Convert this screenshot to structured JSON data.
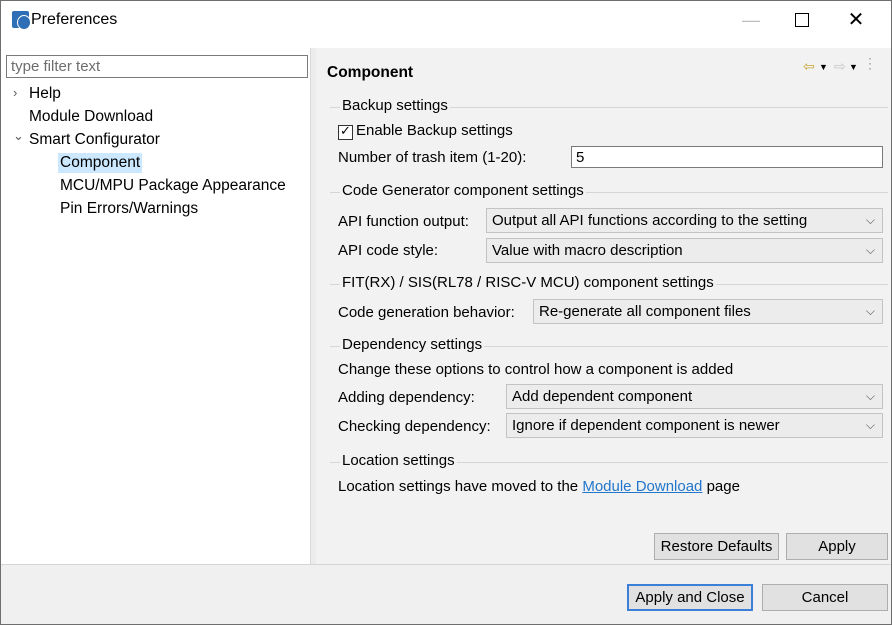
{
  "window": {
    "title": "Preferences",
    "minimize": "—",
    "close": "✕"
  },
  "left": {
    "filter_placeholder": "type filter text",
    "tree": [
      {
        "label": "Help",
        "expander": "›"
      },
      {
        "label": "Module Download"
      },
      {
        "label": "Smart Configurator",
        "expander": "⌄"
      },
      {
        "label": "Component",
        "selected": true
      },
      {
        "label": "MCU/MPU Package Appearance"
      },
      {
        "label": "Pin Errors/Warnings"
      }
    ]
  },
  "right": {
    "page_title": "Component",
    "nav": {
      "back": "⇦",
      "back_menu": "▼",
      "forward": "⇨",
      "forward_menu": "▼"
    },
    "backup": {
      "group": "Backup settings",
      "enable_label": "Enable Backup settings",
      "enable_checked": true,
      "check_glyph": "✓",
      "trash_label": "Number of trash item (1-20):",
      "trash_value": "5"
    },
    "codegen": {
      "group": "Code Generator component settings",
      "api_output_label": "API function output:",
      "api_output_value": "Output all API functions according to the setting",
      "api_style_label": "API code style:",
      "api_style_value": "Value with macro description"
    },
    "fit": {
      "group": "FIT(RX) / SIS(RL78 / RISC-V MCU) component settings",
      "behavior_label": "Code generation behavior:",
      "behavior_value": "Re-generate all component files"
    },
    "dependency": {
      "group": "Dependency settings",
      "description": "Change these options to control how a component is added",
      "adding_label": "Adding dependency:",
      "adding_value": "Add dependent component",
      "checking_label": "Checking dependency:",
      "checking_value": "Ignore if dependent component is newer"
    },
    "location": {
      "group": "Location settings",
      "text_before": "Location settings have moved to the",
      "link": "Module Download",
      "text_after": "page"
    },
    "combo_arrow": "⌵",
    "restore_defaults": "Restore Defaults",
    "apply": "Apply"
  },
  "footer": {
    "apply_close": "Apply and Close",
    "cancel": "Cancel"
  }
}
